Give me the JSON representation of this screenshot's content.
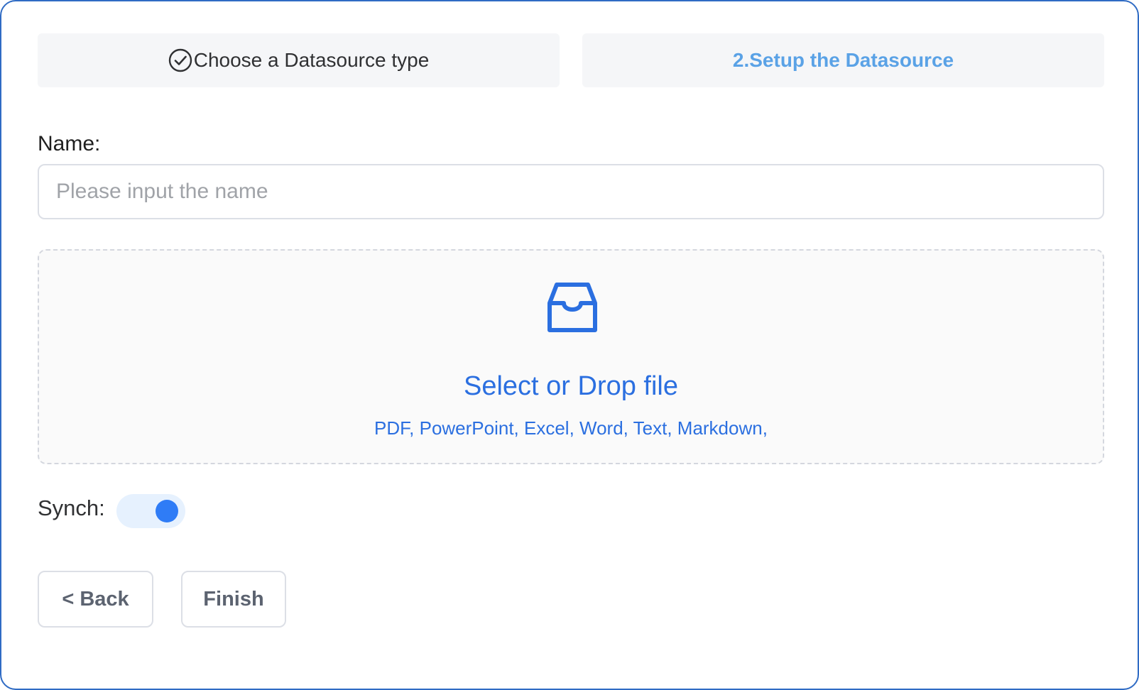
{
  "steps": [
    {
      "label": "Choose a Datasource type",
      "icon": "check-circle-icon",
      "status": "completed"
    },
    {
      "label": "2.Setup the Datasource",
      "status": "active"
    }
  ],
  "form": {
    "name_label": "Name:",
    "name_placeholder": "Please input the name",
    "name_value": ""
  },
  "upload": {
    "icon": "inbox-icon",
    "title": "Select or Drop file",
    "types": "PDF, PowerPoint, Excel, Word, Text, Markdown,"
  },
  "synch": {
    "label": "Synch:",
    "enabled": true
  },
  "buttons": {
    "back": "< Back",
    "finish": "Finish"
  },
  "colors": {
    "accent": "#2b6fe0",
    "active_step": "#5aa2e6",
    "frame_border": "#2f6bc4",
    "toggle_on": "#2f7cf6"
  }
}
